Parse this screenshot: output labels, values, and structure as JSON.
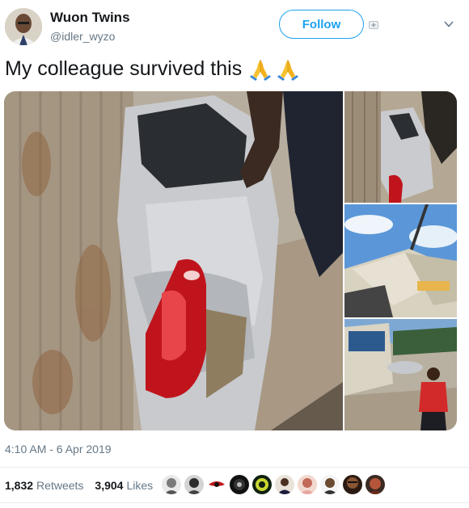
{
  "tweet": {
    "author_name": "Wuon Twins",
    "author_handle": "@idler_wyzo",
    "follow_label": "Follow",
    "text": "My colleague survived this",
    "emoji": [
      "🙏",
      "🙏"
    ],
    "timestamp": "4:10 AM - 6 Apr 2019",
    "retweets_count": "1,832",
    "retweets_label": "Retweets",
    "likes_count": "3,904",
    "likes_label": "Likes"
  },
  "colors": {
    "brand": "#1da1f2",
    "text": "#14171a",
    "muted": "#657786",
    "divider": "#e6ecf0"
  },
  "icons": {
    "follow_plus": "plus-icon",
    "more": "chevron-down-icon"
  },
  "media": {
    "photo_count": 4,
    "liker_count": 10
  }
}
